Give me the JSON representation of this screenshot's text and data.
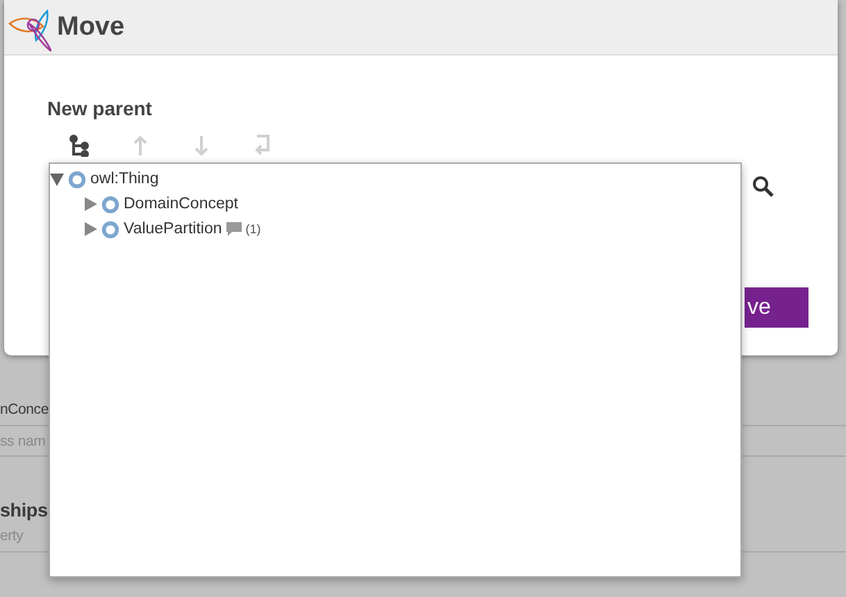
{
  "background": {
    "rows": [
      {
        "text": "nConce",
        "kind": "value"
      },
      {
        "text": "ss nam",
        "kind": "placeholder"
      },
      {
        "text": "ships",
        "kind": "heading"
      },
      {
        "text": "erty",
        "kind": "placeholder"
      }
    ]
  },
  "dialog": {
    "title": "Move",
    "label": "New parent",
    "toolbar": [
      {
        "kind": "hierarchy",
        "disabled": false
      },
      {
        "kind": "up",
        "disabled": true
      },
      {
        "kind": "down",
        "disabled": true
      },
      {
        "kind": "return",
        "disabled": true
      }
    ],
    "button": "ve"
  },
  "tree": [
    {
      "label": "owl:Thing",
      "expanded": true,
      "children": [
        {
          "label": "DomainConcept",
          "expanded": false
        },
        {
          "label": "ValuePartition",
          "expanded": false,
          "comments": "(1)"
        }
      ]
    }
  ]
}
